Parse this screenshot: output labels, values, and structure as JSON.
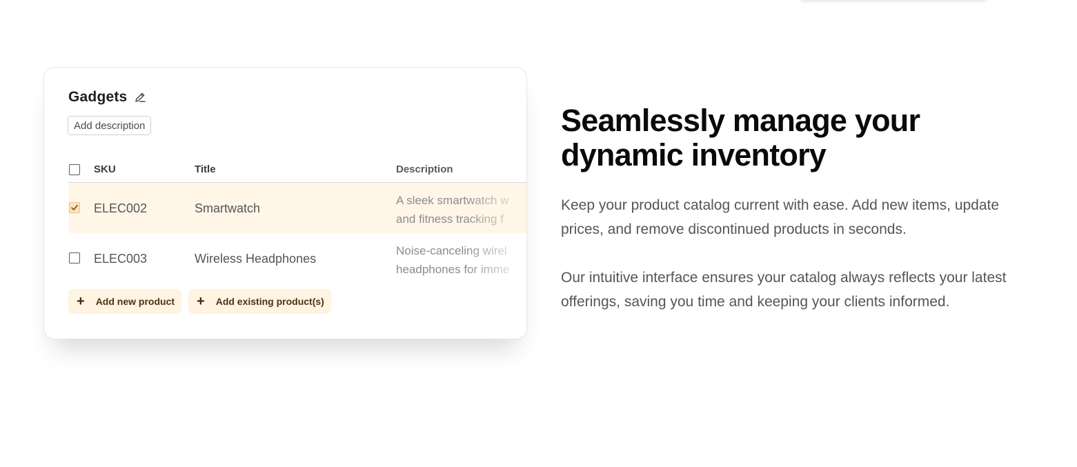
{
  "card": {
    "title": "Gadgets",
    "add_description_label": "Add description",
    "columns": {
      "sku": "SKU",
      "title": "Title",
      "description": "Description"
    },
    "rows": [
      {
        "checked": true,
        "sku": "ELEC002",
        "title": "Smartwatch",
        "desc_line1": "A sleek smartwatch w",
        "desc_line2": "and fitness tracking f"
      },
      {
        "checked": false,
        "sku": "ELEC003",
        "title": "Wireless Headphones",
        "desc_line1": "Noise-canceling wirel",
        "desc_line2": "headphones for imme"
      }
    ],
    "add_new_product_label": "Add new product",
    "add_existing_product_label": "Add existing product(s)"
  },
  "content": {
    "headline": "Seamlessly manage your dynamic inventory",
    "paragraph1": "Keep your product catalog current with ease. Add new items, update prices, and remove discontinued products in seconds.",
    "paragraph2": "Our intuitive interface ensures your catalog always reflects your latest offerings, saving you time and keeping your clients informed."
  },
  "colors": {
    "selected_row_bg": "#fff6e8",
    "action_button_bg": "#fff3e1",
    "checkbox_checked_bg": "#fbe3bd"
  },
  "icons": {
    "edit": "pencil-icon",
    "check": "checkmark-icon",
    "add": "plus-icon"
  }
}
